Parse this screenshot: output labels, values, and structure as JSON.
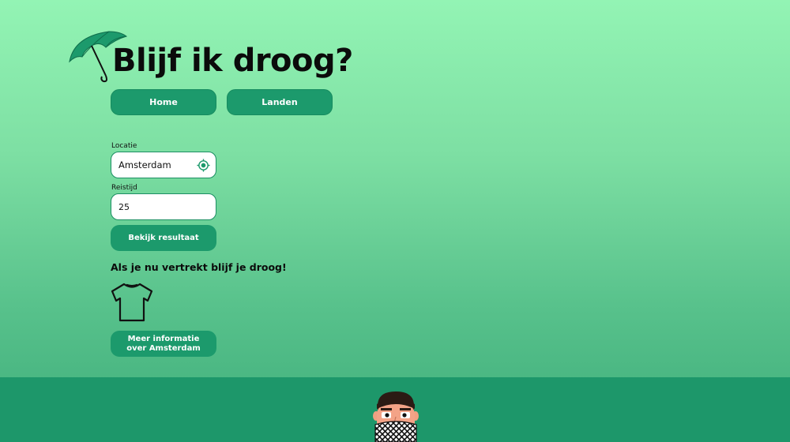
{
  "header": {
    "title": "Blijf ik droog?",
    "logo_icon": "umbrella-icon"
  },
  "nav": {
    "items": [
      {
        "label": "Home"
      },
      {
        "label": "Landen"
      }
    ]
  },
  "form": {
    "location_label": "Locatie",
    "location_value": "Amsterdam",
    "location_icon": "locate-target-icon",
    "traveltime_label": "Reistijd",
    "traveltime_value": "25",
    "submit_label": "Bekijk resultaat"
  },
  "result": {
    "message": "Als je nu vertrekt blijf je droog!",
    "clothing_icon": "tshirt-icon",
    "more_info_label": "Meer informatie over Amsterdam"
  },
  "footer": {
    "avatar_icon": "avatar-icon"
  },
  "colors": {
    "accent": "#1c9a6c",
    "bg_top": "#93f4b4",
    "bg_bottom": "#3fae7b",
    "footer": "#1d976a"
  }
}
